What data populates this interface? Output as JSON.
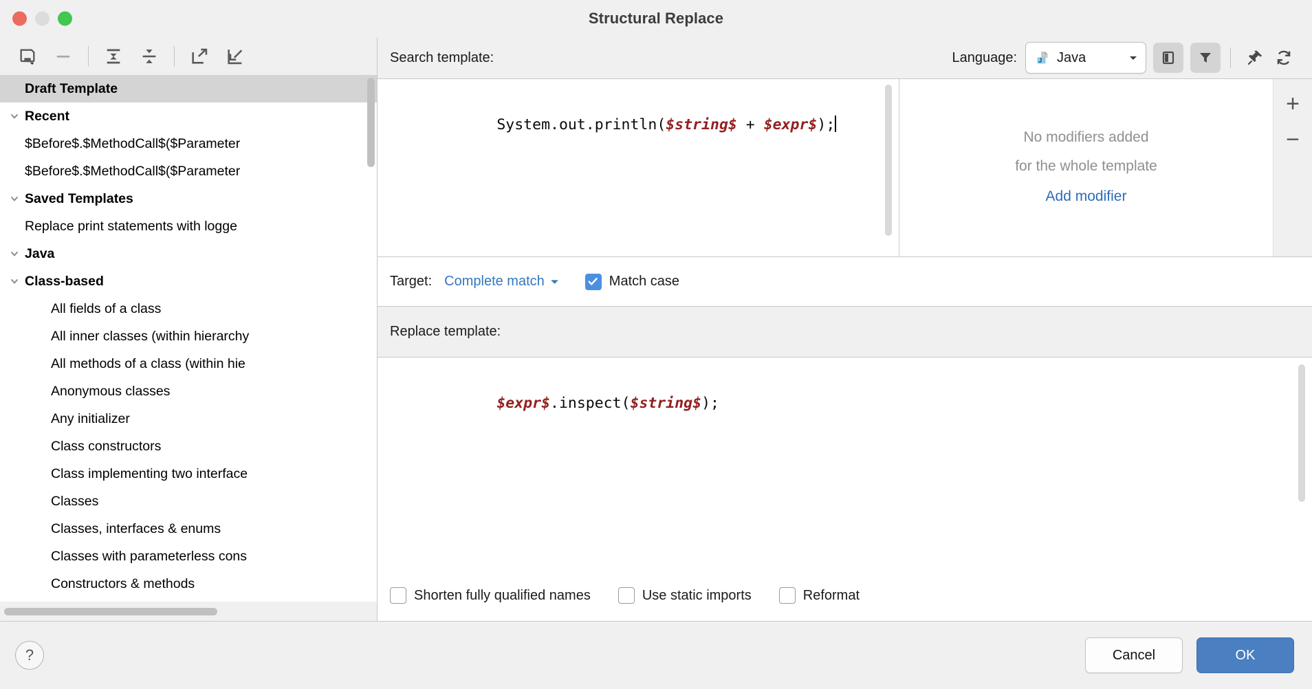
{
  "window": {
    "title": "Structural Replace",
    "traffic_lights": [
      "close",
      "minimize",
      "maximize"
    ]
  },
  "sidebar": {
    "toolbar": [
      {
        "name": "save-template-icon",
        "label": "Save template"
      },
      {
        "name": "remove-template-icon",
        "label": "Remove template"
      },
      {
        "name": "expand-all-icon",
        "label": "Expand all"
      },
      {
        "name": "collapse-all-icon",
        "label": "Collapse all"
      },
      {
        "name": "export-icon",
        "label": "Export template"
      },
      {
        "name": "import-icon",
        "label": "Import template"
      }
    ],
    "tree": [
      {
        "label": "Draft Template",
        "depth": 0,
        "bold": true,
        "selected": true,
        "twisty": "none"
      },
      {
        "label": "Recent",
        "depth": 0,
        "bold": true,
        "selected": false,
        "twisty": "expanded"
      },
      {
        "label": "$Before$.$MethodCall$($Parameter",
        "depth": 1,
        "bold": false,
        "selected": false,
        "twisty": "none"
      },
      {
        "label": "$Before$.$MethodCall$($Parameter",
        "depth": 1,
        "bold": false,
        "selected": false,
        "twisty": "none"
      },
      {
        "label": "Saved Templates",
        "depth": 0,
        "bold": true,
        "selected": false,
        "twisty": "expanded"
      },
      {
        "label": "Replace print statements with logge",
        "depth": 1,
        "bold": false,
        "selected": false,
        "twisty": "none"
      },
      {
        "label": "Java",
        "depth": 0,
        "bold": true,
        "selected": false,
        "twisty": "expanded"
      },
      {
        "label": "Class-based",
        "depth": 1,
        "bold": true,
        "selected": false,
        "twisty": "expanded"
      },
      {
        "label": "All fields of a class",
        "depth": 2,
        "bold": false,
        "selected": false,
        "twisty": "none"
      },
      {
        "label": "All inner classes (within hierarchy",
        "depth": 2,
        "bold": false,
        "selected": false,
        "twisty": "none"
      },
      {
        "label": "All methods of a class (within hie",
        "depth": 2,
        "bold": false,
        "selected": false,
        "twisty": "none"
      },
      {
        "label": "Anonymous classes",
        "depth": 2,
        "bold": false,
        "selected": false,
        "twisty": "none"
      },
      {
        "label": "Any initializer",
        "depth": 2,
        "bold": false,
        "selected": false,
        "twisty": "none"
      },
      {
        "label": "Class constructors",
        "depth": 2,
        "bold": false,
        "selected": false,
        "twisty": "none"
      },
      {
        "label": "Class implementing two interface",
        "depth": 2,
        "bold": false,
        "selected": false,
        "twisty": "none"
      },
      {
        "label": "Classes",
        "depth": 2,
        "bold": false,
        "selected": false,
        "twisty": "none"
      },
      {
        "label": "Classes, interfaces & enums",
        "depth": 2,
        "bold": false,
        "selected": false,
        "twisty": "none"
      },
      {
        "label": "Classes with parameterless cons",
        "depth": 2,
        "bold": false,
        "selected": false,
        "twisty": "none"
      },
      {
        "label": "Constructors & methods",
        "depth": 2,
        "bold": false,
        "selected": false,
        "twisty": "none"
      }
    ]
  },
  "search": {
    "label": "Search template:",
    "language_label": "Language:",
    "language_value": "Java",
    "code": {
      "prefix": "System.out.println(",
      "var1": "$string$",
      "middle": " + ",
      "var2": "$expr$",
      "suffix": ");"
    },
    "header_buttons": [
      {
        "name": "toggle-modifier-panel-icon",
        "label": "Toggle modifier panel",
        "active": true
      },
      {
        "name": "filter-icon",
        "label": "Filter",
        "active": true
      },
      {
        "name": "pin-icon",
        "label": "Pin",
        "active": false
      },
      {
        "name": "reset-icon",
        "label": "Reset template",
        "active": false
      }
    ]
  },
  "modifiers": {
    "line1": "No modifiers added",
    "line2": "for the whole template",
    "add_link": "Add modifier",
    "add_button": "+",
    "remove_button": "−"
  },
  "target": {
    "label": "Target:",
    "value": "Complete match",
    "match_case_label": "Match case",
    "match_case_checked": true
  },
  "replace": {
    "label": "Replace template:",
    "code": {
      "var1": "$expr$",
      "middle": ".inspect(",
      "var2": "$string$",
      "suffix": ");"
    },
    "options": [
      {
        "label": "Shorten fully qualified names",
        "checked": false
      },
      {
        "label": "Use static imports",
        "checked": false
      },
      {
        "label": "Reformat",
        "checked": false
      }
    ]
  },
  "footer": {
    "help_label": "?",
    "cancel_label": "Cancel",
    "ok_label": "OK"
  },
  "colors": {
    "accent_blue": "#4a7fc1",
    "link_blue": "#3576bd",
    "variable_red": "#932020",
    "selection_gray": "#d4d4d4"
  }
}
